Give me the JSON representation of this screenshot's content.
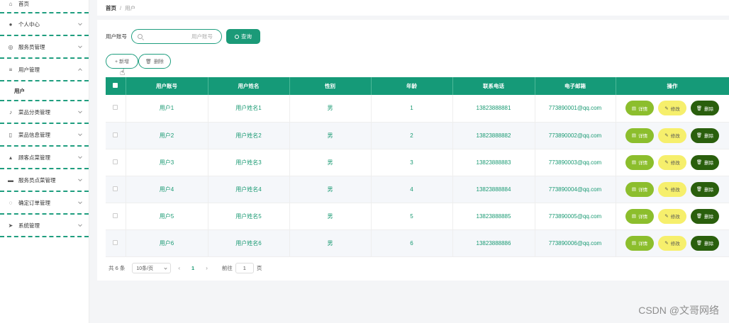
{
  "sidebar": {
    "home": {
      "label": "首页",
      "icon": "home-icon"
    },
    "items": [
      {
        "label": "个人中心",
        "icon": "user-icon"
      },
      {
        "label": "服务员管理",
        "icon": "globe-icon"
      },
      {
        "label": "用户管理",
        "icon": "list-icon",
        "expanded": true,
        "sub": [
          "用户"
        ]
      },
      {
        "label": "菜品分类管理",
        "icon": "mic-icon"
      },
      {
        "label": "菜品信息管理",
        "icon": "phone-icon"
      },
      {
        "label": "顾客点菜管理",
        "icon": "thumb-icon"
      },
      {
        "label": "服务员点菜管理",
        "icon": "briefcase-icon"
      },
      {
        "label": "确定订单管理",
        "icon": "circle-icon"
      },
      {
        "label": "系统管理",
        "icon": "send-icon"
      }
    ]
  },
  "breadcrumb": {
    "home": "首页",
    "separator": "/",
    "current": "用户"
  },
  "search": {
    "label": "用户账号",
    "placeholder": "用户账号",
    "button": "查询"
  },
  "actions": {
    "add": "+ 新增",
    "delete": "删除"
  },
  "table": {
    "headers": [
      "用户账号",
      "用户姓名",
      "性别",
      "年龄",
      "联系电话",
      "电子邮箱",
      "操作"
    ],
    "rows": [
      [
        "用户1",
        "用户姓名1",
        "男",
        "1",
        "13823888881",
        "773890001@qq.com"
      ],
      [
        "用户2",
        "用户姓名2",
        "男",
        "2",
        "13823888882",
        "773890002@qq.com"
      ],
      [
        "用户3",
        "用户姓名3",
        "男",
        "3",
        "13823888883",
        "773890003@qq.com"
      ],
      [
        "用户4",
        "用户姓名4",
        "男",
        "4",
        "13823888884",
        "773890004@qq.com"
      ],
      [
        "用户5",
        "用户姓名5",
        "男",
        "5",
        "13823888885",
        "773890005@qq.com"
      ],
      [
        "用户6",
        "用户姓名6",
        "男",
        "6",
        "13823888886",
        "773890006@qq.com"
      ]
    ],
    "ops": {
      "detail": "详情",
      "edit": "修改",
      "remove": "删除"
    }
  },
  "pager": {
    "total": "共 6 条",
    "size": "10条/页",
    "prev": "‹",
    "current": "1",
    "next": "›",
    "goto": "前往",
    "page": "1",
    "unit": "页"
  },
  "watermark": "CSDN @文哥网络",
  "colors": {
    "accent": "#159a78",
    "detail": "#8cbe2d",
    "edit": "#f6ef6c",
    "remove": "#2a5f0d"
  }
}
